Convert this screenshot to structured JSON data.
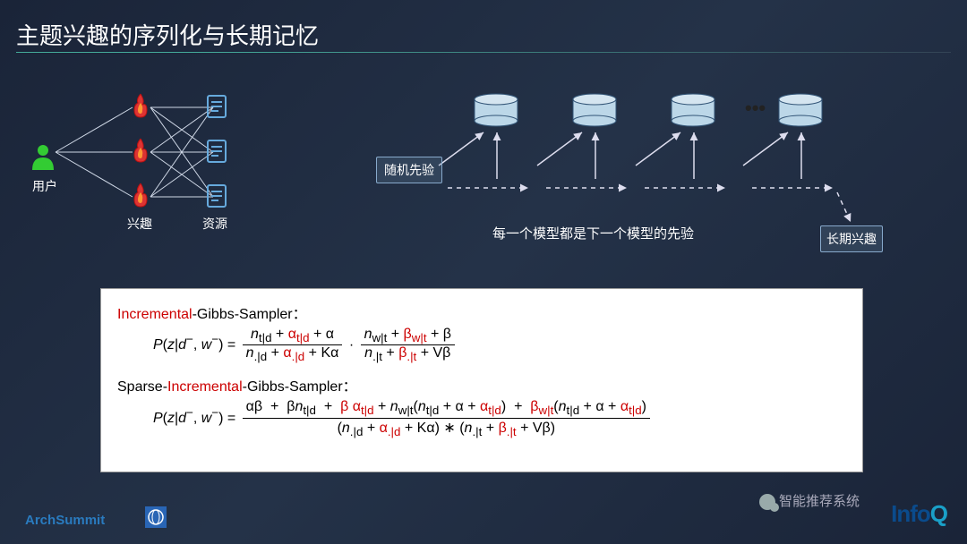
{
  "title": "主题兴趣的序列化与长期记忆",
  "graph": {
    "user": "用户",
    "interest": "兴趣",
    "resource": "资源"
  },
  "prior": "随机先验",
  "caption": "每一个模型都是下一个模型的先验",
  "ltm": "长期兴趣",
  "eq": {
    "t1a": "Incremental",
    "t1b": "-Gibbs-Sampler：",
    "t2a": "Sparse-",
    "t2b": "Incremental",
    "t2c": "-Gibbs-Sampler："
  },
  "footer": {
    "archsummit": "ArchSummit",
    "infoq_i": "Info",
    "infoq_q": "Q",
    "wechat": "智能推荐系统"
  },
  "chart_data": {
    "type": "diagram",
    "title": "主题兴趣的序列化与长期记忆",
    "left_graph": {
      "layers": [
        {
          "name": "用户",
          "nodes": 1,
          "icon": "person",
          "color": "green"
        },
        {
          "name": "兴趣",
          "nodes": 3,
          "icon": "flame",
          "color": "red-orange"
        },
        {
          "name": "资源",
          "nodes": 3,
          "icon": "document",
          "color": "blue"
        }
      ],
      "edges": "fully-connected between adjacent layers (bipartite)"
    },
    "sequence": {
      "input_label": "随机先验",
      "models": 4,
      "ellipsis_after": 3,
      "model_icon": "database-cylinder",
      "caption": "每一个模型都是下一个模型的先验",
      "output_label": "长期兴趣",
      "arrows": "each model receives an arrow from prior/previous model; dashed arrows chain models left-to-right"
    },
    "formulas": [
      {
        "name": "Incremental-Gibbs-Sampler",
        "incremental_terms": [
          "α_{t|d}",
          "α_{.|d}",
          "β_{w|t}",
          "β_{.|t}"
        ],
        "expression": "P(z|d^-,w^-) = (n_{t|d} + α_{t|d} + α) / (n_{.|d} + α_{.|d} + Kα) · (n_{w|t} + β_{w|t} + β) / (n_{.|t} + β_{.|t} + Vβ)"
      },
      {
        "name": "Sparse-Incremental-Gibbs-Sampler",
        "incremental_terms": [
          "α_{t|d}",
          "α_{.|d}",
          "β_{w|t}",
          "β_{.|t}",
          "α_{t|d}",
          "α_{t|d}"
        ],
        "expression": "P(z|d^-,w^-) = [ αβ + β n_{t|d} + β α_{t|d} + n_{w|t}(n_{t|d}+α+α_{t|d}) + β_{w|t}(n_{t|d}+α+α_{t|d}) ] / [ (n_{.|d}+α_{.|d}+Kα) * (n_{.|t}+β_{.|t}+Vβ) ]"
      }
    ],
    "annotations": [
      "red-colored symbols denote incremental prior terms"
    ]
  }
}
